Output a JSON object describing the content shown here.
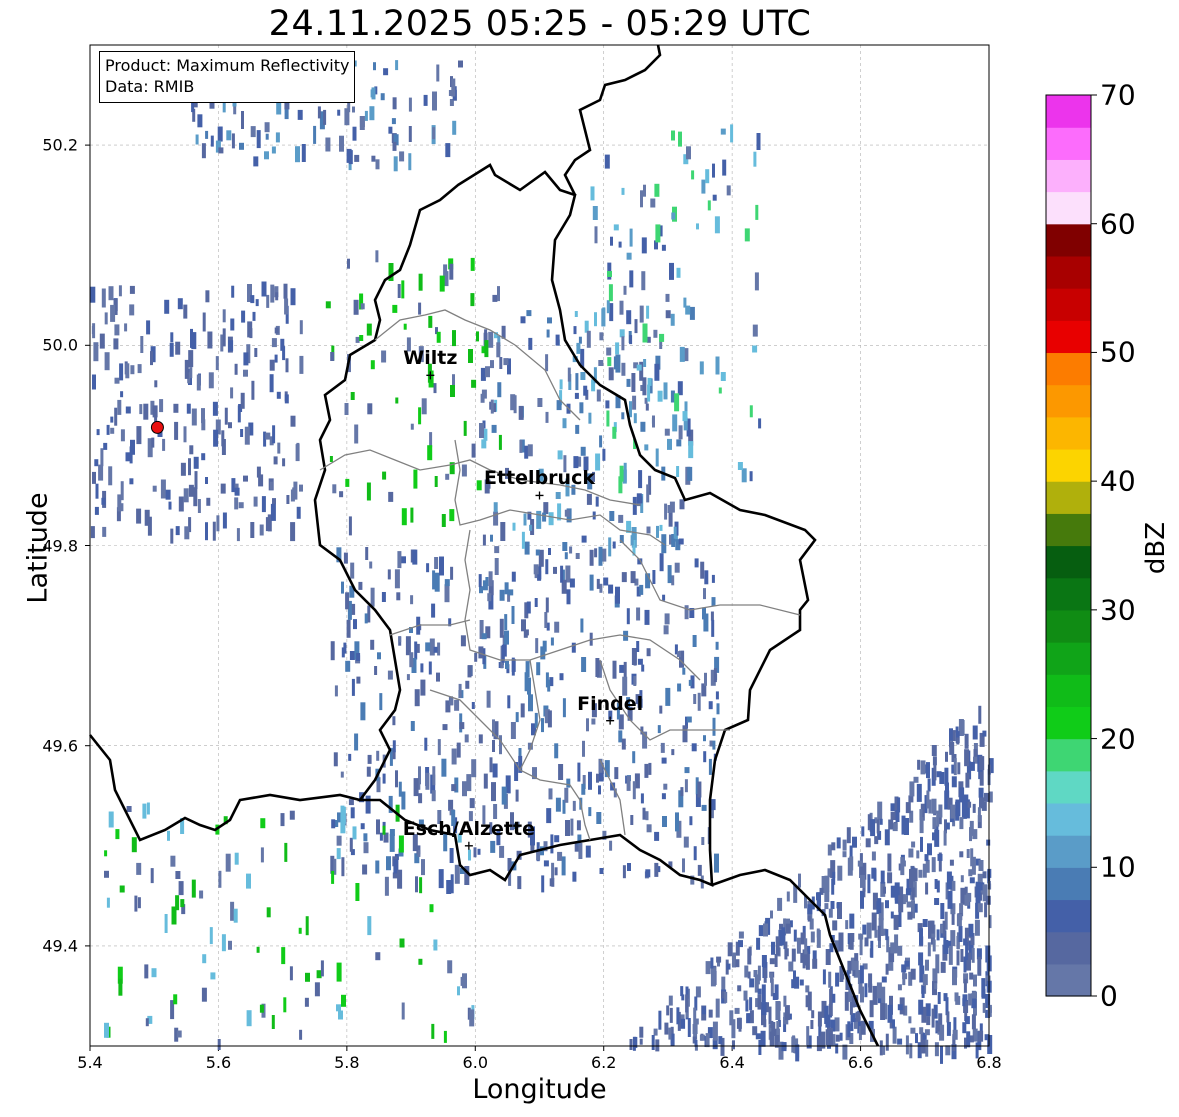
{
  "title": "24.11.2025 05:25 - 05:29 UTC",
  "info": {
    "product": "Product: Maximum Reflectivity",
    "data": "Data: RMIB"
  },
  "axes": {
    "xlabel": "Longitude",
    "ylabel": "Latitude",
    "xlim": [
      5.4,
      6.8
    ],
    "ylim": [
      49.3,
      50.3
    ],
    "xticks": [
      "5.4",
      "5.6",
      "5.8",
      "6.0",
      "6.2",
      "6.4",
      "6.6",
      "6.8"
    ],
    "yticks": [
      "49.4",
      "49.6",
      "49.8",
      "50.0",
      "50.2"
    ],
    "grid": true
  },
  "colorbar": {
    "label": "dBZ",
    "range": [
      0,
      70
    ],
    "ticks": [
      "0",
      "10",
      "20",
      "30",
      "40",
      "50",
      "60",
      "70"
    ],
    "colors": [
      "#6577a8",
      "#5668a0",
      "#4460a8",
      "#4a7cb4",
      "#5a9cc8",
      "#66bcdc",
      "#5fd8c4",
      "#3ed673",
      "#10cc18",
      "#10bc18",
      "#10a418",
      "#108c14",
      "#0a7614",
      "#065e10",
      "#467a0c",
      "#b0b00c",
      "#fcd400",
      "#fcb600",
      "#fc9800",
      "#fc7c00",
      "#e80000",
      "#c80000",
      "#a80000",
      "#800000",
      "#fce0fc",
      "#fcb0fc",
      "#fc6cfc",
      "#ec34ec"
    ]
  },
  "cities": [
    {
      "name": "Wiltz",
      "lon": 5.93,
      "lat": 49.97
    },
    {
      "name": "Ettelbruck",
      "lon": 6.1,
      "lat": 49.85
    },
    {
      "name": "Findel",
      "lon": 6.21,
      "lat": 49.625
    },
    {
      "name": "Esch/Alzette",
      "lon": 5.99,
      "lat": 49.5
    }
  ],
  "marker": {
    "lon": 5.505,
    "lat": 49.918,
    "color": "#e81010"
  },
  "colors": {
    "border": "#000000",
    "canton": "#808080",
    "grid": "#b0b0b0"
  }
}
